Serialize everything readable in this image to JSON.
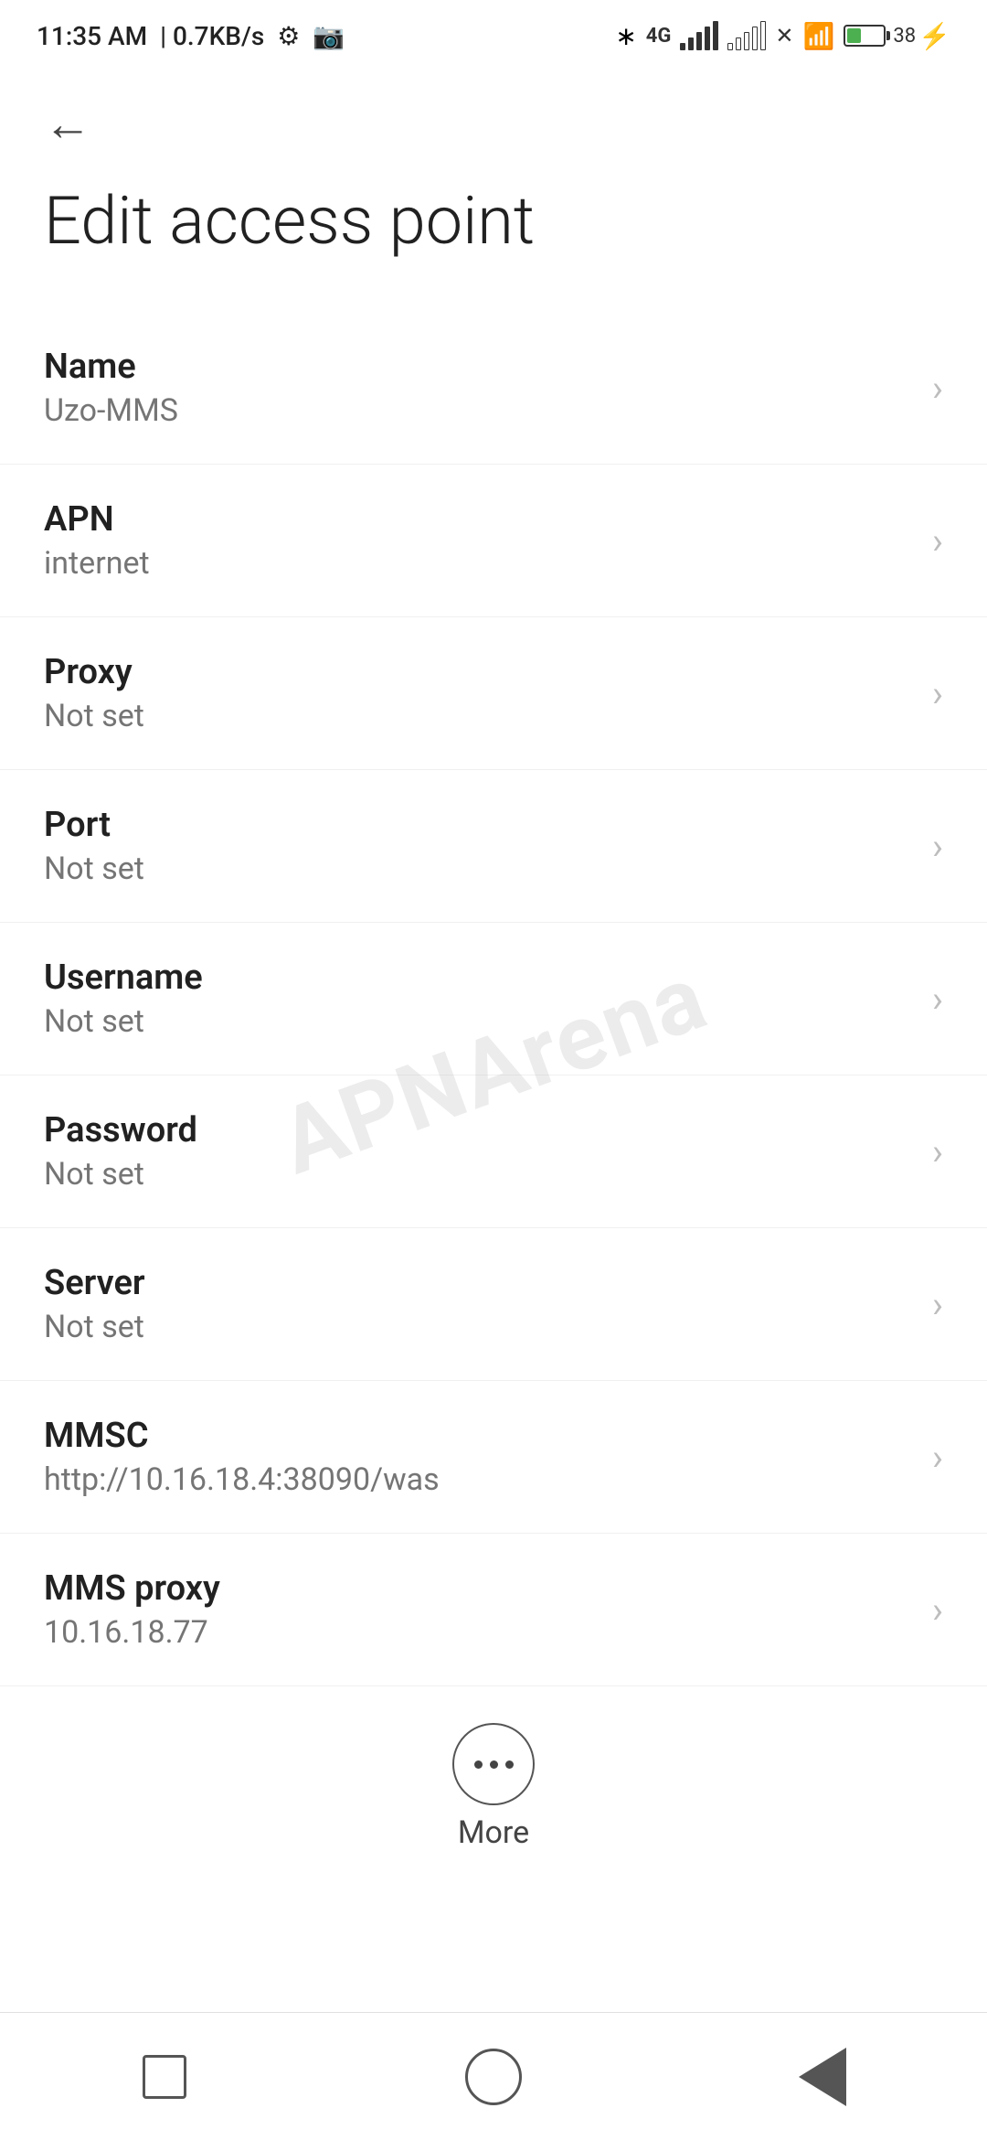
{
  "statusBar": {
    "time": "11:35 AM",
    "speed": "0.7KB/s"
  },
  "header": {
    "backLabel": "←",
    "title": "Edit access point"
  },
  "settings": {
    "items": [
      {
        "label": "Name",
        "value": "Uzo-MMS"
      },
      {
        "label": "APN",
        "value": "internet"
      },
      {
        "label": "Proxy",
        "value": "Not set"
      },
      {
        "label": "Port",
        "value": "Not set"
      },
      {
        "label": "Username",
        "value": "Not set"
      },
      {
        "label": "Password",
        "value": "Not set"
      },
      {
        "label": "Server",
        "value": "Not set"
      },
      {
        "label": "MMSC",
        "value": "http://10.16.18.4:38090/was"
      },
      {
        "label": "MMS proxy",
        "value": "10.16.18.77"
      }
    ]
  },
  "more": {
    "label": "More"
  },
  "watermark": "APNArena"
}
